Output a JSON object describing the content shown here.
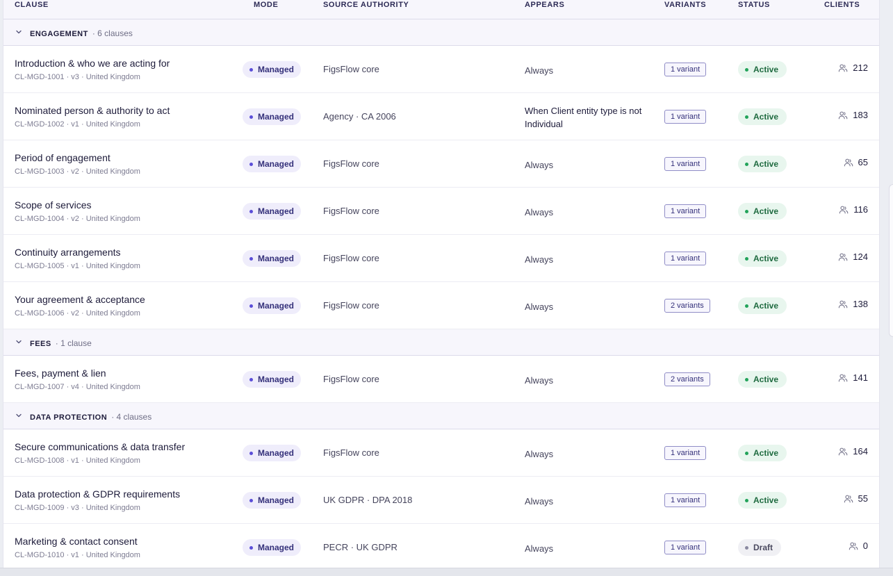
{
  "columns": {
    "clause": "CLAUSE",
    "mode": "MODE",
    "source": "SOURCE AUTHORITY",
    "appears": "APPEARS",
    "variants": "VARIANTS",
    "status": "STATUS",
    "clients": "CLIENTS"
  },
  "groups": [
    {
      "name": "ENGAGEMENT",
      "count": "· 6 clauses",
      "rows": [
        {
          "title": "Introduction & who we are acting for",
          "meta": "CL-MGD-1001 · v3 · United Kingdom",
          "mode": "Managed",
          "source": "FigsFlow core",
          "appears": "Always",
          "variants": "1 variant",
          "status": "Active",
          "clients": "212"
        },
        {
          "title": "Nominated person & authority to act",
          "meta": "CL-MGD-1002 · v1 · United Kingdom",
          "mode": "Managed",
          "source": "Agency · CA 2006",
          "appears": "When Client entity type is not Individual",
          "variants": "1 variant",
          "status": "Active",
          "clients": "183"
        },
        {
          "title": "Period of engagement",
          "meta": "CL-MGD-1003 · v2 · United Kingdom",
          "mode": "Managed",
          "source": "FigsFlow core",
          "appears": "Always",
          "variants": "1 variant",
          "status": "Active",
          "clients": "65"
        },
        {
          "title": "Scope of services",
          "meta": "CL-MGD-1004 · v2 · United Kingdom",
          "mode": "Managed",
          "source": "FigsFlow core",
          "appears": "Always",
          "variants": "1 variant",
          "status": "Active",
          "clients": "116"
        },
        {
          "title": "Continuity arrangements",
          "meta": "CL-MGD-1005 · v1 · United Kingdom",
          "mode": "Managed",
          "source": "FigsFlow core",
          "appears": "Always",
          "variants": "1 variant",
          "status": "Active",
          "clients": "124"
        },
        {
          "title": "Your agreement & acceptance",
          "meta": "CL-MGD-1006 · v2 · United Kingdom",
          "mode": "Managed",
          "source": "FigsFlow core",
          "appears": "Always",
          "variants": "2 variants",
          "status": "Active",
          "clients": "138"
        }
      ]
    },
    {
      "name": "FEES",
      "count": "· 1 clause",
      "rows": [
        {
          "title": "Fees, payment & lien",
          "meta": "CL-MGD-1007 · v4 · United Kingdom",
          "mode": "Managed",
          "source": "FigsFlow core",
          "appears": "Always",
          "variants": "2 variants",
          "status": "Active",
          "clients": "141"
        }
      ]
    },
    {
      "name": "DATA PROTECTION",
      "count": "· 4 clauses",
      "rows": [
        {
          "title": "Secure communications & data transfer",
          "meta": "CL-MGD-1008 · v1 · United Kingdom",
          "mode": "Managed",
          "source": "FigsFlow core",
          "appears": "Always",
          "variants": "1 variant",
          "status": "Active",
          "clients": "164"
        },
        {
          "title": "Data protection & GDPR requirements",
          "meta": "CL-MGD-1009 · v3 · United Kingdom",
          "mode": "Managed",
          "source": "UK GDPR · DPA 2018",
          "appears": "Always",
          "variants": "1 variant",
          "status": "Active",
          "clients": "55"
        },
        {
          "title": "Marketing & contact consent",
          "meta": "CL-MGD-1010 · v1 · United Kingdom",
          "mode": "Managed",
          "source": "PECR · UK GDPR",
          "appears": "Always",
          "variants": "1 variant",
          "status": "Draft",
          "clients": "0"
        }
      ]
    }
  ],
  "icons": {
    "group_toggle": "chevron-down-icon",
    "clients": "users-icon"
  }
}
